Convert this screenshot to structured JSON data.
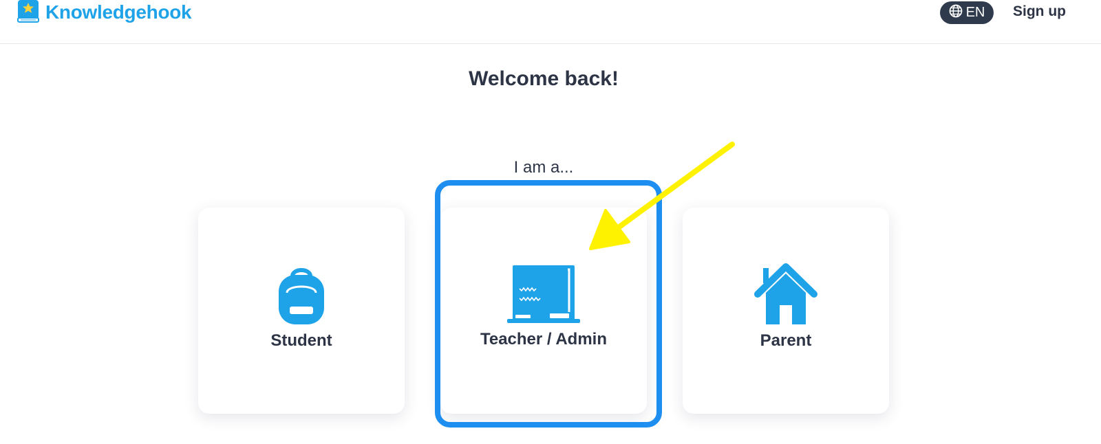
{
  "header": {
    "logo_text": "Knowledgehook",
    "language_label": "EN",
    "signup_label": "Sign up"
  },
  "main": {
    "title": "Welcome back!",
    "prompt": "I am a...",
    "roles": [
      {
        "label": "Student",
        "icon": "backpack-icon"
      },
      {
        "label": "Teacher / Admin",
        "icon": "chalkboard-icon"
      },
      {
        "label": "Parent",
        "icon": "house-icon"
      }
    ]
  },
  "colors": {
    "brand": "#1fa3e8",
    "text": "#2c3445",
    "highlight": "#1e8ff0",
    "annotation_arrow": "#fff200"
  }
}
